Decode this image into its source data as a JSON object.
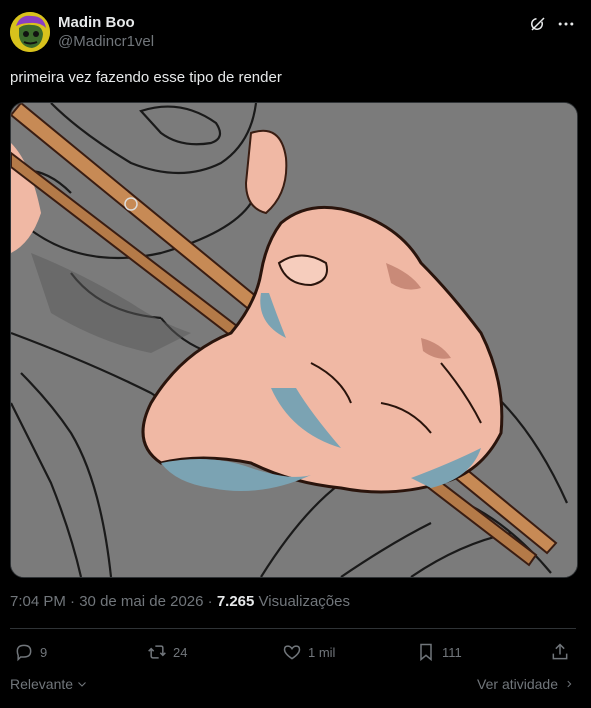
{
  "author": {
    "display_name": "Madin Boo",
    "handle": "@Madincr1vel"
  },
  "icons": {
    "header": [
      "grok-icon",
      "more-icon"
    ],
    "actions": [
      "reply-icon",
      "retweet-icon",
      "like-icon",
      "bookmark-icon",
      "share-icon"
    ]
  },
  "tweet": {
    "text": "primeira vez fazendo esse tipo de render"
  },
  "meta": {
    "time": "7:04 PM",
    "separator": "·",
    "date": "30 de mai de 2026",
    "views_count": "7.265",
    "views_label": "Visualizações"
  },
  "actions": {
    "replies": "9",
    "retweets": "24",
    "likes": "1 mil",
    "bookmarks": "111"
  },
  "footer": {
    "sort_label": "Relevante",
    "activity_label": "Ver atividade"
  },
  "colors": {
    "background": "#000000",
    "text": "#e7e9ea",
    "secondary": "#71767b",
    "divider": "#2f3336",
    "canvas": "#7a7a7a",
    "skin": "#f0b8a4",
    "stick": "#c78a55"
  }
}
